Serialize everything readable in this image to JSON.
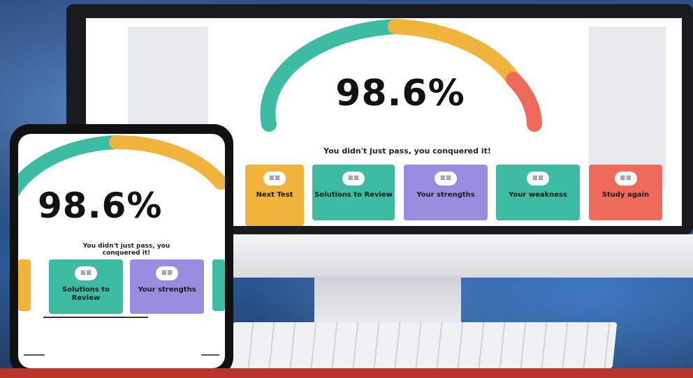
{
  "colors": {
    "teal": "#3dbba3",
    "orange": "#f0b33c",
    "purple": "#9b8ce0",
    "red": "#ee6a5a"
  },
  "desktop": {
    "score": "98.6%",
    "tagline": "You didn't just pass, you conquered it!",
    "tiles": [
      {
        "icon": "tile-icon",
        "color": "#f0b33c",
        "label": "Next Test"
      },
      {
        "icon": "tile-icon",
        "color": "#3dbba3",
        "label": "Solutions to Review"
      },
      {
        "icon": "tile-icon",
        "color": "#9b8ce0",
        "label": "Your strengths"
      },
      {
        "icon": "tile-icon",
        "color": "#3dbba3",
        "label": "Your weakness"
      },
      {
        "icon": "tile-icon",
        "color": "#ee6a5a",
        "label": "Study again"
      }
    ]
  },
  "mobile": {
    "score": "98.6%",
    "tagline": "You didn't just pass, you conquered it!",
    "tiles": [
      {
        "icon": "tile-icon",
        "color": "#3dbba3",
        "label": "Solutions to Review"
      },
      {
        "icon": "tile-icon",
        "color": "#9b8ce0",
        "label": "Your strengths"
      }
    ]
  }
}
